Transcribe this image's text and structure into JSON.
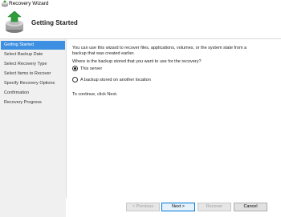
{
  "window": {
    "title": "Recovery Wizard"
  },
  "header": {
    "heading": "Getting Started"
  },
  "sidebar": {
    "steps": [
      {
        "label": "Getting Started",
        "active": true
      },
      {
        "label": "Select Backup Date"
      },
      {
        "label": "Select Recovery Type"
      },
      {
        "label": "Select Items to Recover"
      },
      {
        "label": "Specify Recovery Options"
      },
      {
        "label": "Confirmation"
      },
      {
        "label": "Recovery Progress"
      }
    ]
  },
  "main": {
    "intro": "You can use this wizard to recover files, applications, volumes, or the system state from a backup that was created earlier.",
    "question": "Where is the backup stored that you want to use for the recovery?",
    "options": [
      {
        "label": "This server",
        "selected": true
      },
      {
        "label": "A backup stored on another location",
        "selected": false
      }
    ],
    "continue_text": "To continue, click Next."
  },
  "footer": {
    "previous_label": "< Previous",
    "next_label": "Next >",
    "recover_label": "Recover",
    "cancel_label": "Cancel"
  },
  "colors": {
    "accent": "#3d8fe1",
    "sidebar_bg": "#f0f0f0"
  }
}
